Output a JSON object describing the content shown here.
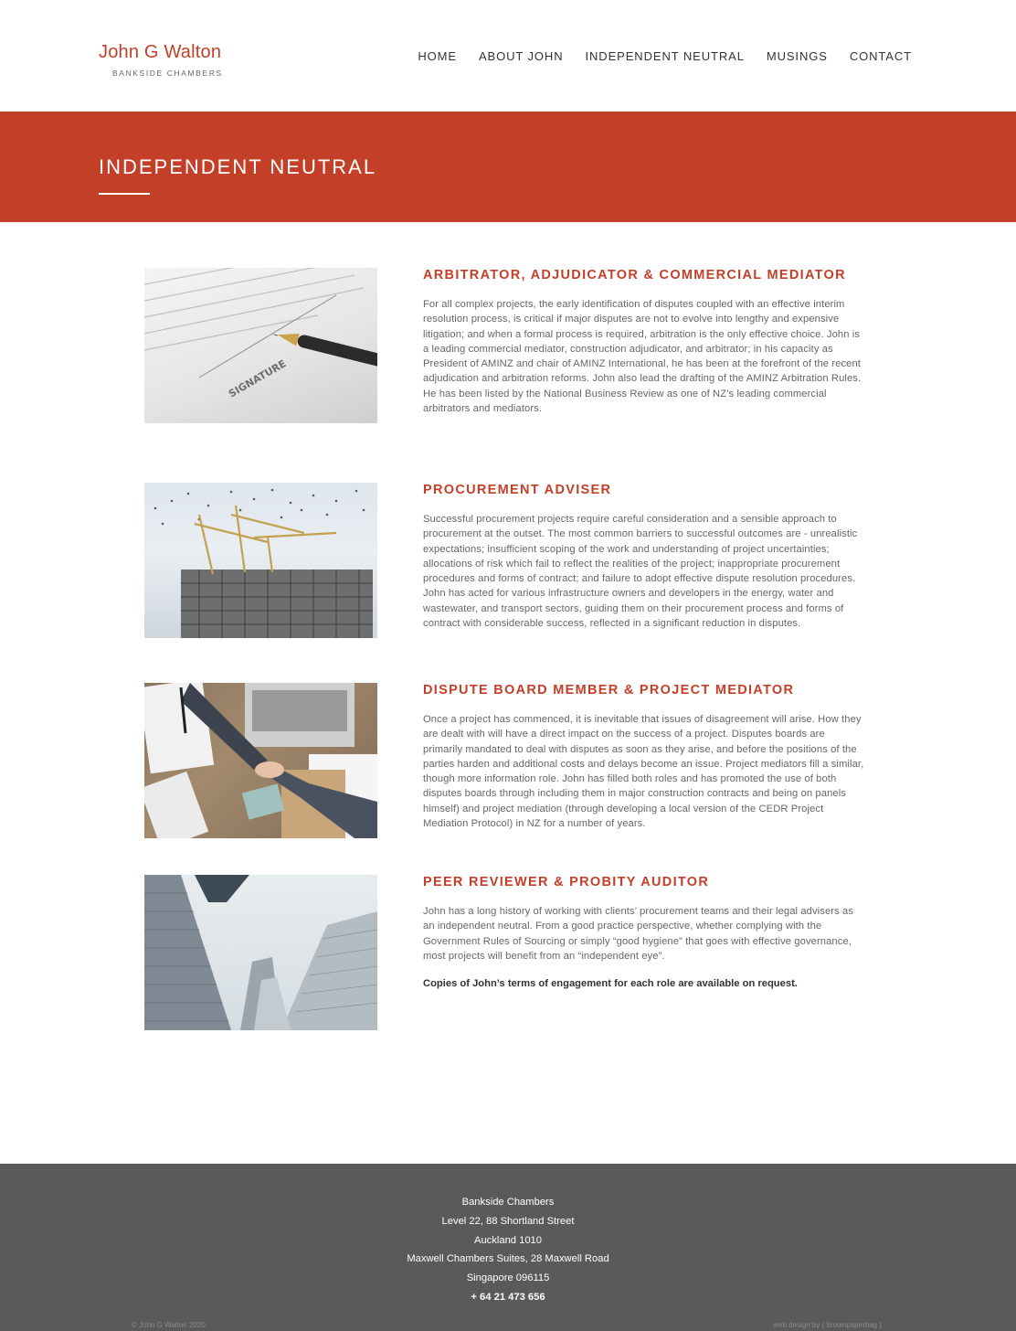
{
  "header": {
    "logo_name": "John G Walton",
    "logo_sub": "BANKSIDE CHAMBERS",
    "nav": [
      "HOME",
      "ABOUT JOHN",
      "INDEPENDENT NEUTRAL",
      "MUSINGS",
      "CONTACT"
    ]
  },
  "banner": {
    "title": "INDEPENDENT NEUTRAL"
  },
  "sections": [
    {
      "heading": "ARBITRATOR, ADJUDICATOR & COMMERCIAL MEDIATOR",
      "text": "For all complex projects, the early identification of disputes coupled with an effective interim resolution process, is critical if major disputes are not to evolve into lengthy and expensive litigation; and when a formal process is required, arbitration is the only effective choice. John is a leading commercial mediator, construction adjudicator, and arbitrator; in his capacity as President of AMINZ and chair of AMINZ International, he has been at the forefront of the recent adjudication and arbitration reforms. John also lead the drafting of the AMINZ Arbitration Rules. He has been listed by the National Business Review as one of NZ’s leading commercial arbitrators and mediators."
    },
    {
      "heading": "PROCUREMENT ADVISER",
      "text": "Successful procurement projects require careful consideration and a sensible approach to procurement at the outset. The most common barriers to successful outcomes are - unrealistic expectations; insufficient scoping of the work and understanding of project uncertainties; allocations of risk which fail to reflect the realities of the project; inappropriate procurement procedures and forms of contract; and failure to adopt effective dispute resolution procedures. John has acted for various infrastructure owners and developers in the energy, water and wastewater, and transport sectors, guiding them on their procurement process and forms of contract with considerable success, reflected in a significant reduction in disputes."
    },
    {
      "heading": "DISPUTE BOARD MEMBER & PROJECT MEDIATOR",
      "text": "Once a project has commenced, it is inevitable that issues of disagreement will arise. How they are dealt with will have a direct impact on the success of a project. Disputes boards are primarily mandated to deal with disputes as soon as they arise, and before the positions of the parties harden and additional costs and delays become an issue. Project mediators fill a similar, though more information role. John has filled both roles and has promoted the use of both disputes boards through including them in major construction contracts and being on panels himself) and project mediation (through developing a local version of the CEDR Project Mediation Protocol) in NZ for a number of years."
    },
    {
      "heading": "PEER REVIEWER & PROBITY AUDITOR",
      "text": "John has a long history of working with clients’ procurement teams and their legal advisers as an independent neutral. From a good practice perspective, whether complying with the Government Rules of Sourcing or simply “good hygiene” that goes with effective governance, most projects will benefit from an “independent eye”.",
      "note": "Copies of John’s terms of engagement for each role are available on request."
    }
  ],
  "images": {
    "doc_signature_label": "SIGNATURE",
    "icons": [
      "document-signing-image",
      "construction-cranes-image",
      "business-handshake-image",
      "skyscrapers-image"
    ]
  },
  "footer": {
    "lines": [
      "Bankside Chambers",
      "Level 22, 88 Shortland Street",
      "Auckland 1010",
      "Maxwell Chambers Suites, 28 Maxwell Road",
      "Singapore 096115"
    ],
    "phone": "+ 64 21 473 656",
    "copyright": "© John G Walton 2020",
    "credit": "web design by { brownpaperbag }"
  },
  "colors": {
    "accent": "#c43f28",
    "footer_bg": "#5a5a5a",
    "text": "#666666"
  }
}
